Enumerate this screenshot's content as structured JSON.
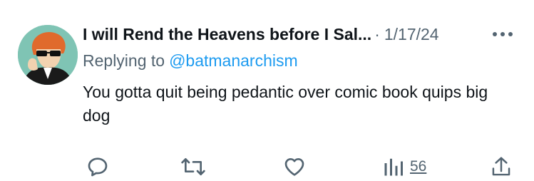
{
  "tweet": {
    "author_name": "I will Rend the Heavens before I Sal...",
    "separator": "·",
    "date": "1/17/24",
    "replying_prefix": "Replying to",
    "replying_handle": "@batmanarchism",
    "text": "You gotta quit being pedantic over comic book quips big dog",
    "views": "56"
  },
  "icons": {
    "more": "more-dots-icon",
    "reply": "reply-bubble-icon",
    "repost": "repost-arrows-icon",
    "like": "heart-icon",
    "views": "bar-chart-icon",
    "share": "share-upload-icon"
  },
  "colors": {
    "text": "#0f1419",
    "secondary": "#536471",
    "link": "#1d9bf0",
    "avatar_bg": "#7fc4b4"
  }
}
